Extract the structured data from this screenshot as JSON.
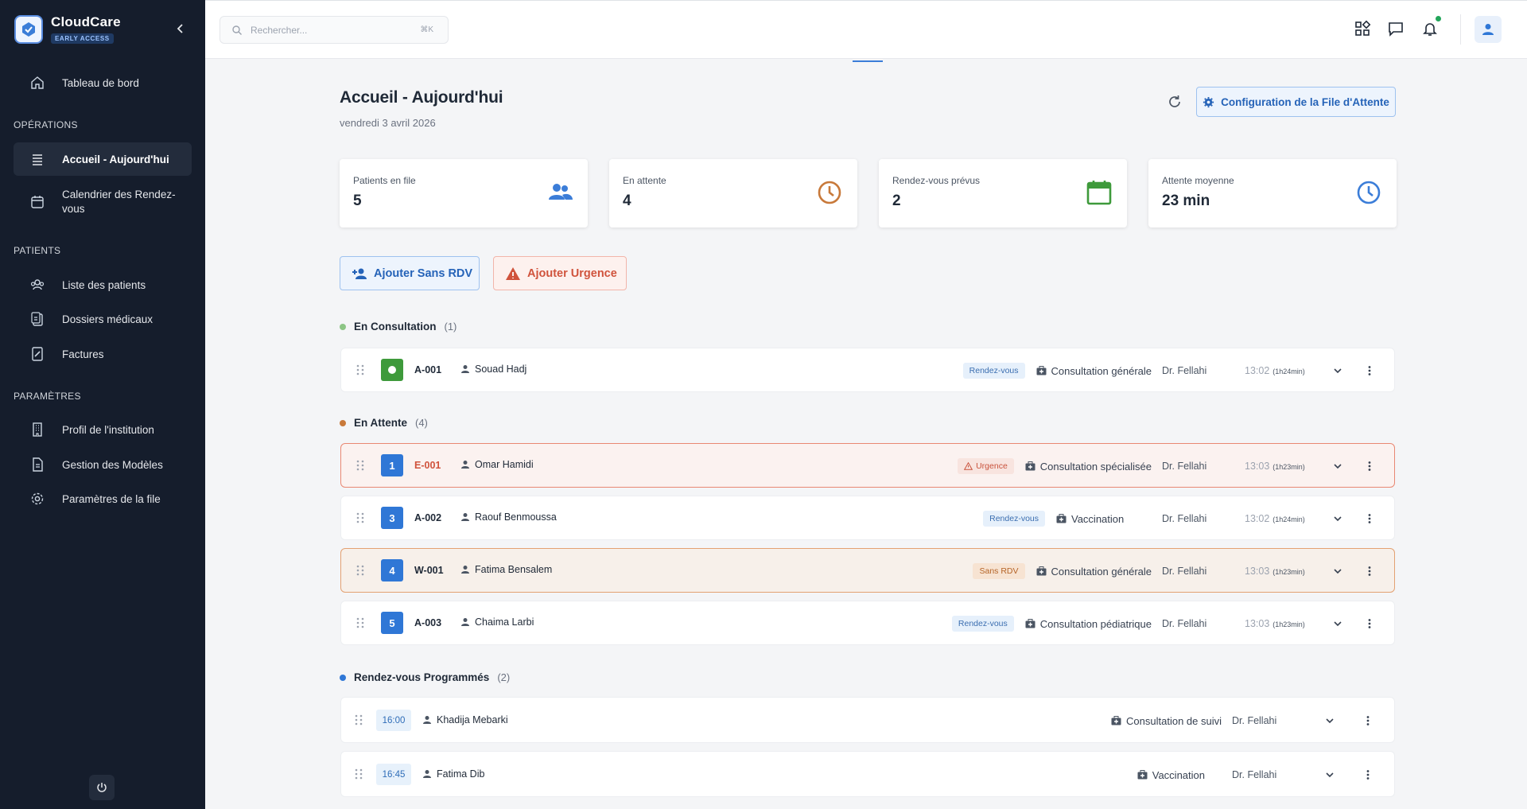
{
  "brand": {
    "name": "CloudCare",
    "badge": "EARLY ACCESS"
  },
  "sidebar": {
    "items": [
      {
        "label": "Tableau de bord",
        "icon": "home-icon"
      },
      {
        "label": "Accueil - Aujourd'hui",
        "icon": "list-icon",
        "active": true
      },
      {
        "label": "Calendrier des Rendez-vous",
        "icon": "calendar-icon"
      },
      {
        "label": "Liste des patients",
        "icon": "users-icon"
      },
      {
        "label": "Dossiers médicaux",
        "icon": "clipboard-icon"
      },
      {
        "label": "Factures",
        "icon": "invoice-icon"
      },
      {
        "label": "Profil de l'institution",
        "icon": "building-icon"
      },
      {
        "label": "Gestion des Modèles",
        "icon": "file-icon"
      },
      {
        "label": "Paramètres de la file",
        "icon": "gear-icon"
      }
    ],
    "sections": {
      "operations": "OPÉRATIONS",
      "patients": "PATIENTS",
      "settings": "PARAMÈTRES"
    }
  },
  "search": {
    "placeholder": "Rechercher...",
    "shortcut": "⌘K"
  },
  "header": {
    "title": "Accueil - Aujourd'hui",
    "date": "vendredi 3 avril 2026",
    "config_label": "Configuration de la File d'Attente"
  },
  "stats": [
    {
      "label": "Patients en file",
      "value": "5",
      "icon": "group-icon",
      "color": "#3b7dd8"
    },
    {
      "label": "En attente",
      "value": "4",
      "icon": "clock-icon",
      "color": "#c8793a"
    },
    {
      "label": "Rendez-vous prévus",
      "value": "2",
      "icon": "calendar-icon",
      "color": "#3e9a3b"
    },
    {
      "label": "Attente moyenne",
      "value": "23 min",
      "icon": "clock-icon",
      "color": "#3b7dd8"
    }
  ],
  "actions": {
    "walkin": "Ajouter Sans RDV",
    "emergency": "Ajouter Urgence"
  },
  "sections": {
    "consultation": {
      "title": "En Consultation",
      "count": "(1)"
    },
    "waiting": {
      "title": "En Attente",
      "count": "(4)"
    },
    "scheduled": {
      "title": "Rendez-vous Programmés",
      "count": "(2)"
    }
  },
  "consultation_rows": [
    {
      "code": "A-001",
      "patient": "Souad Hadj",
      "tag": "Rendez-vous",
      "service": "Consultation générale",
      "doctor": "Dr. Fellahi",
      "time": "13:02",
      "duration": "(1h24min)"
    }
  ],
  "waiting_rows": [
    {
      "position": "1",
      "code": "E-001",
      "patient": "Omar Hamidi",
      "tag": "Urgence",
      "service": "Consultation spécialisée",
      "doctor": "Dr. Fellahi",
      "time": "13:03",
      "duration": "(1h23min)"
    },
    {
      "position": "3",
      "code": "A-002",
      "patient": "Raouf Benmoussa",
      "tag": "Rendez-vous",
      "service": "Vaccination",
      "doctor": "Dr. Fellahi",
      "time": "13:02",
      "duration": "(1h24min)"
    },
    {
      "position": "4",
      "code": "W-001",
      "patient": "Fatima Bensalem",
      "tag": "Sans RDV",
      "service": "Consultation générale",
      "doctor": "Dr. Fellahi",
      "time": "13:03",
      "duration": "(1h23min)"
    },
    {
      "position": "5",
      "code": "A-003",
      "patient": "Chaima Larbi",
      "tag": "Rendez-vous",
      "service": "Consultation pédiatrique",
      "doctor": "Dr. Fellahi",
      "time": "13:03",
      "duration": "(1h23min)"
    }
  ],
  "scheduled_rows": [
    {
      "time": "16:00",
      "patient": "Khadija Mebarki",
      "service": "Consultation de suivi",
      "doctor": "Dr. Fellahi"
    },
    {
      "time": "16:45",
      "patient": "Fatima Dib",
      "service": "Vaccination",
      "doctor": "Dr. Fellahi"
    }
  ]
}
